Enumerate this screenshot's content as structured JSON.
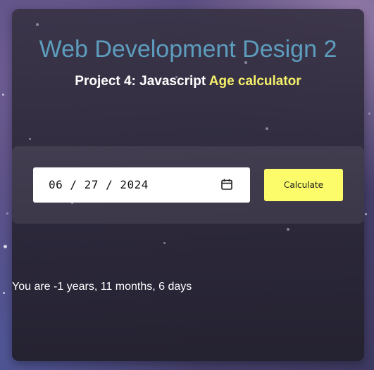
{
  "header": {
    "title": "Web Development Design 2",
    "subtitle_prefix": "Project 4: Javascript",
    "subtitle_accent": "Age calculator"
  },
  "form": {
    "date_value": "06 / 27 / 2024",
    "calculate_label": "Calculate"
  },
  "result": {
    "text": "You are -1 years, 11 months, 6 days"
  },
  "colors": {
    "title": "#5d9dbd",
    "accent": "#f5f06a",
    "button": "#fcfc6a",
    "card": "#3a3448"
  },
  "icons": {
    "date_picker": "calendar-icon"
  }
}
